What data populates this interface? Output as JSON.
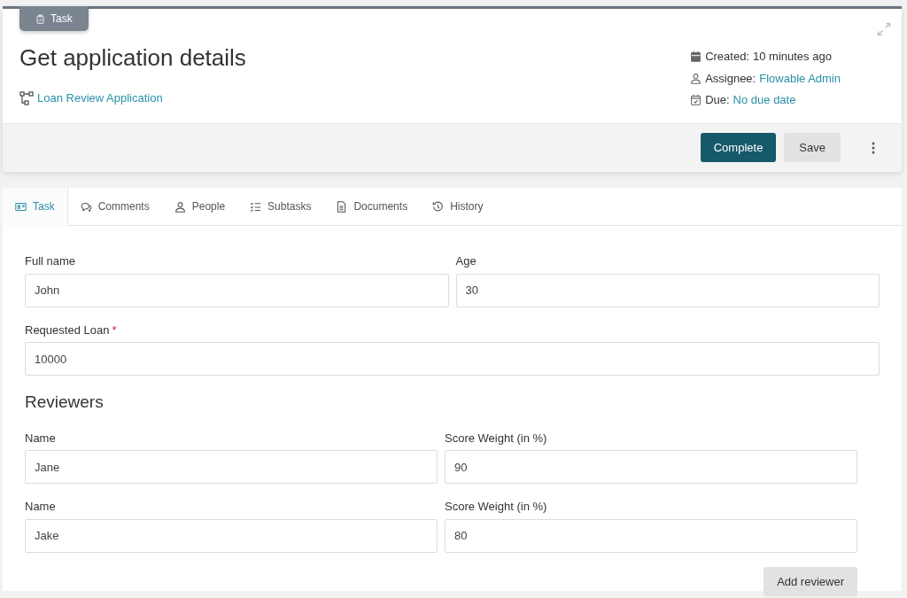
{
  "header": {
    "badge": "Task",
    "title": "Get application details",
    "process_link": "Loan Review Application",
    "meta": [
      {
        "label": "Created:",
        "value": "10 minutes ago",
        "kind": "text"
      },
      {
        "label": "Assignee:",
        "value": "Flowable Admin",
        "kind": "link"
      },
      {
        "label": "Due:",
        "value": "No due date",
        "kind": "link"
      }
    ],
    "actions": [
      {
        "label": "Complete",
        "kind": "primary"
      },
      {
        "label": "Save",
        "kind": "secondary"
      }
    ]
  },
  "tabs": [
    {
      "label": "Task",
      "selected": true
    },
    {
      "label": "Comments",
      "selected": false
    },
    {
      "label": "People",
      "selected": false
    },
    {
      "label": "Subtasks",
      "selected": false
    },
    {
      "label": "Documents",
      "selected": false
    },
    {
      "label": "History",
      "selected": false
    }
  ],
  "form": {
    "rows": [
      [
        {
          "label": "Full name",
          "value": "John"
        },
        {
          "label": "Age",
          "value": "30"
        }
      ],
      [
        {
          "label": "Requested Loan",
          "required_mark": "*",
          "value": "10000"
        }
      ]
    ],
    "reviewers": {
      "heading": "Reviewers",
      "rows": [
        [
          {
            "label": "Name",
            "value": "Jane"
          },
          {
            "label": "Score Weight (in %)",
            "value": "90"
          }
        ],
        [
          {
            "label": "Name",
            "value": "Jake"
          },
          {
            "label": "Score Weight (in %)",
            "value": "80"
          }
        ]
      ],
      "add_button": "Add reviewer"
    }
  }
}
